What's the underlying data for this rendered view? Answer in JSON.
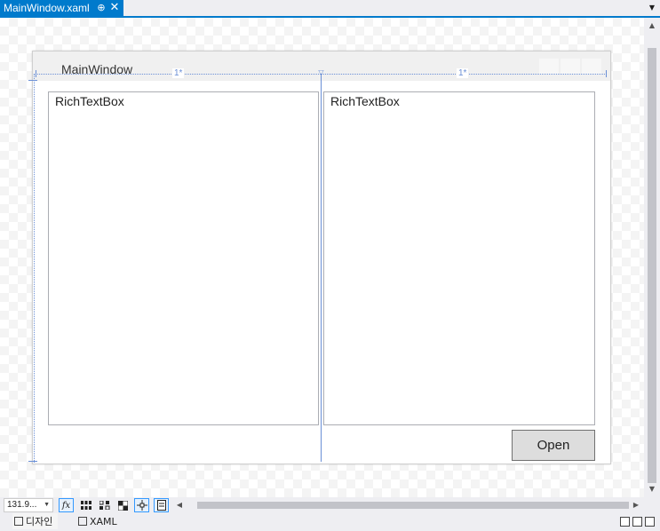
{
  "tab": {
    "title": "MainWindow.xaml",
    "pin_icon": "pin-icon",
    "close_icon": "close-icon",
    "menu_icon": "chevron-down-icon"
  },
  "window": {
    "title": "MainWindow"
  },
  "grid": {
    "columns": [
      {
        "label": "1*"
      },
      {
        "label": "1*"
      }
    ]
  },
  "controls": {
    "rich_text_left": "RichTextBox",
    "rich_text_right": "RichTextBox",
    "open_button": "Open"
  },
  "toolbar": {
    "zoom": "131.9...",
    "fx": "fx"
  },
  "views": {
    "design": "디자인",
    "xaml": "XAML"
  },
  "colors": {
    "accent": "#007acc",
    "guide": "#6a8fd6"
  }
}
